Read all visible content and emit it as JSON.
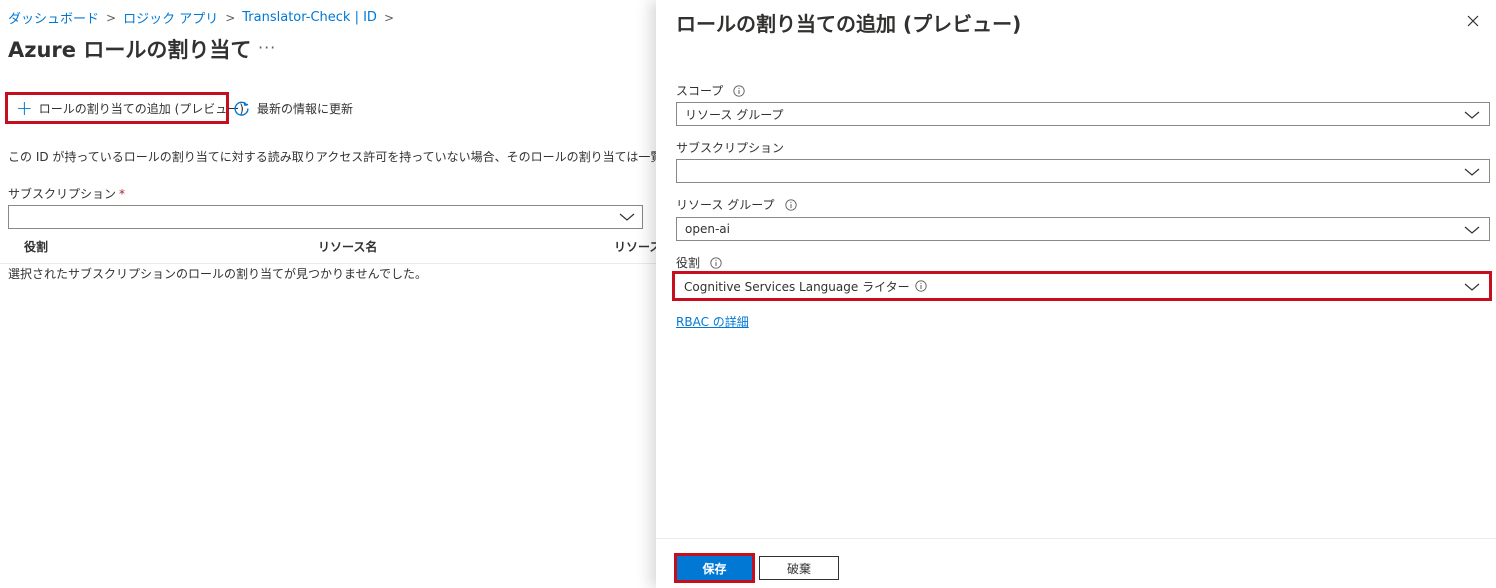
{
  "breadcrumb": {
    "items": [
      {
        "label": "ダッシュボード"
      },
      {
        "label": "ロジック アプリ"
      },
      {
        "label": "Translator-Check | ID"
      }
    ]
  },
  "main": {
    "title": "Azure ロールの割り当て",
    "more": "···",
    "commands": {
      "add_label": "ロールの割り当ての追加 (プレビュー)",
      "refresh_label": "最新の情報に更新"
    },
    "info_text": "この ID が持っているロールの割り当てに対する読み取りアクセス許可を持っていない場合、そのロールの割り当ては一覧に表示されません。",
    "subscription_label": "サブスクリプション",
    "subscription_required": "*",
    "subscription_value": "",
    "table": {
      "columns": [
        "役割",
        "リソース名",
        "リソース"
      ]
    },
    "empty_message": "選択されたサブスクリプションのロールの割り当てが見つかりませんでした。"
  },
  "panel": {
    "title": "ロールの割り当ての追加 (プレビュー)",
    "fields": {
      "scope": {
        "label": "スコープ",
        "value": "リソース グループ"
      },
      "subscription": {
        "label": "サブスクリプション",
        "value": ""
      },
      "resource_group": {
        "label": "リソース グループ",
        "value": "open-ai"
      },
      "role": {
        "label": "役割",
        "value": "Cognitive Services Language ライター"
      }
    },
    "rbac_link": "RBAC の詳細",
    "save_label": "保存",
    "discard_label": "破棄"
  },
  "colors": {
    "accent": "#0078d4",
    "highlight": "#c50f1f",
    "text": "#323130"
  }
}
